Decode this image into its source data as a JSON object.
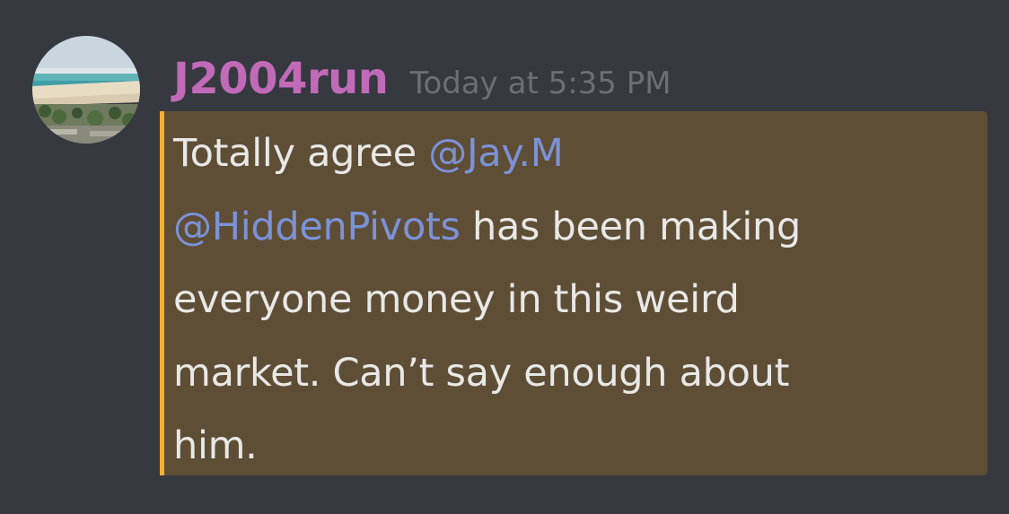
{
  "message": {
    "author": "J2004run",
    "timestamp": "Today at 5:35 PM",
    "lines": [
      {
        "prefix": "Totally agree ",
        "mention": "@Jay.M",
        "suffix": ""
      },
      {
        "prefix": "",
        "mention": "@HiddenPivots",
        "suffix": " has been making"
      },
      {
        "prefix": "everyone money in this weird",
        "mention": "",
        "suffix": ""
      },
      {
        "prefix": "market.  Can’t say enough about",
        "mention": "",
        "suffix": ""
      },
      {
        "prefix": "him.",
        "mention": "",
        "suffix": ""
      }
    ]
  },
  "colors": {
    "background": "#36393f",
    "username": "#c16ab8",
    "timestamp": "#6b6f77",
    "mention_highlight": "#5e4e36",
    "mention_bar": "#f0b232",
    "mention_text": "#7c92d8",
    "message_text": "#e8e8e6"
  },
  "avatar": {
    "icon": "beach-photo-avatar"
  }
}
